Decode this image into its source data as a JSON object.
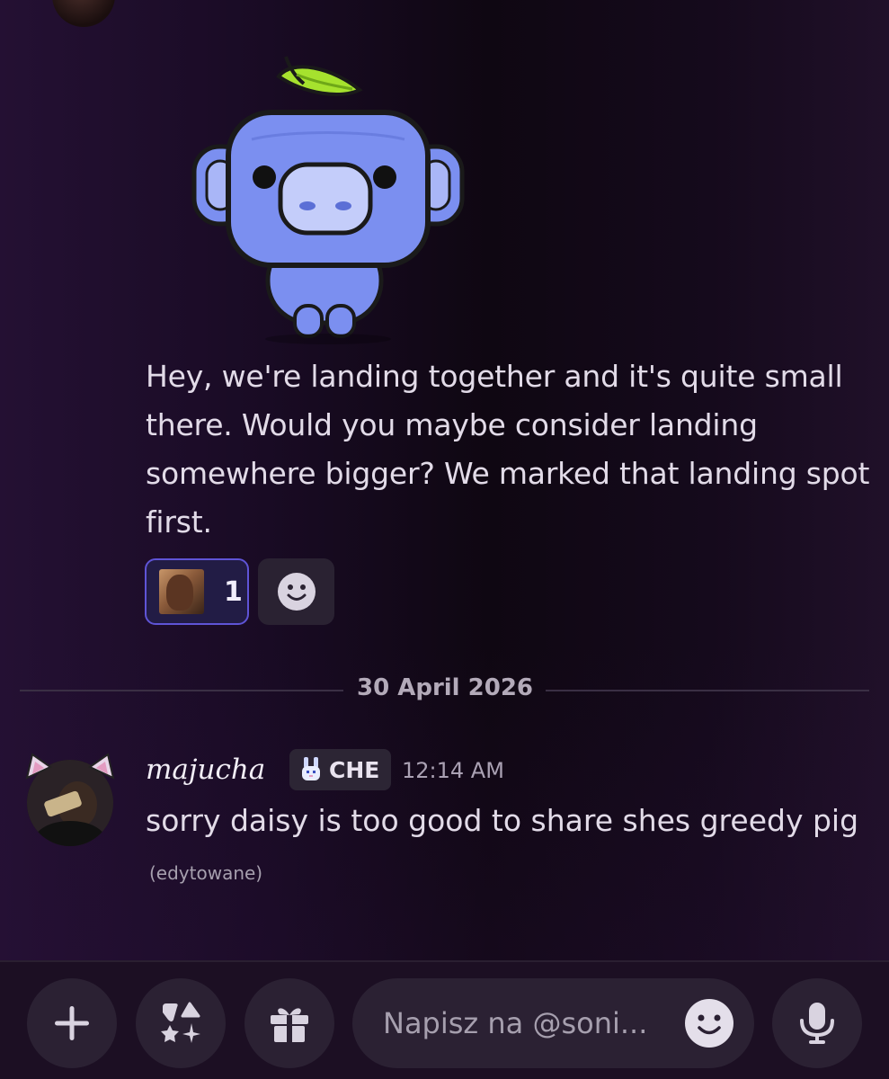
{
  "message1": {
    "text": "Hey, we're landing together and it's quite small there. Would you maybe consider landing somewhere bigger? We marked that landing spot first.",
    "reaction_count": "1"
  },
  "divider": {
    "date": "30 April 2026"
  },
  "message2": {
    "username": "majucha",
    "tag": "CHE",
    "timestamp": "12:14 AM",
    "text": "sorry daisy is too good to share shes greedy pig",
    "edited": "(edytowane)"
  },
  "composer": {
    "placeholder": "Napisz na @soni..."
  },
  "colors": {
    "reaction_border": "#5f54d6",
    "mascot_blue": "#7b8ff0",
    "leaf_green": "#a6e22e"
  },
  "icons": {
    "plus": "plus-icon",
    "apps": "apps-icon",
    "gift": "gift-icon",
    "emoji": "smile-icon",
    "mic": "microphone-icon",
    "tag": "bunny-icon"
  }
}
